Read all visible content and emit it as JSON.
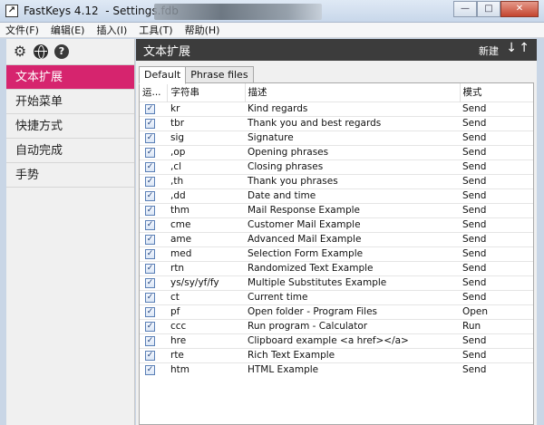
{
  "window": {
    "title": "FastKeys 4.12  - Settings.fdb",
    "app_icon": "↗",
    "minimize": "—",
    "maximize": "□",
    "close": "✕"
  },
  "menu": [
    "文件(F)",
    "编辑(E)",
    "插入(I)",
    "工具(T)",
    "帮助(H)"
  ],
  "toolbar_icons": [
    "gear-icon",
    "globe-icon",
    "help-icon"
  ],
  "toolbar_glyphs": {
    "gear": "⚙",
    "help": "?"
  },
  "nav": [
    {
      "label": "文本扩展",
      "active": true
    },
    {
      "label": "开始菜单",
      "active": false
    },
    {
      "label": "快捷方式",
      "active": false
    },
    {
      "label": "自动完成",
      "active": false
    },
    {
      "label": "手势",
      "active": false
    }
  ],
  "main": {
    "title": "文本扩展",
    "new_label": "新建",
    "down_arrow": "↓",
    "up_arrow": "↑",
    "tabs": [
      "Default",
      "Phrase files"
    ]
  },
  "table": {
    "headers": [
      "运...",
      "字符串",
      "描述",
      "模式"
    ],
    "check_mark": "✓",
    "rows": [
      {
        "abbr": "kr",
        "desc": "Kind regards",
        "mode": "Send"
      },
      {
        "abbr": "tbr",
        "desc": "Thank you and best regards",
        "mode": "Send"
      },
      {
        "abbr": "sig",
        "desc": "Signature",
        "mode": "Send"
      },
      {
        "abbr": ",op",
        "desc": "Opening phrases",
        "mode": "Send"
      },
      {
        "abbr": ",cl",
        "desc": "Closing phrases",
        "mode": "Send"
      },
      {
        "abbr": ",th",
        "desc": "Thank you phrases",
        "mode": "Send"
      },
      {
        "abbr": ",dd",
        "desc": "Date and time",
        "mode": "Send"
      },
      {
        "abbr": "thm",
        "desc": "Mail Response Example",
        "mode": "Send"
      },
      {
        "abbr": "cme",
        "desc": "Customer Mail Example",
        "mode": "Send"
      },
      {
        "abbr": "ame",
        "desc": "Advanced Mail Example",
        "mode": "Send"
      },
      {
        "abbr": "med",
        "desc": "Selection Form Example",
        "mode": "Send"
      },
      {
        "abbr": "rtn",
        "desc": "Randomized Text Example",
        "mode": "Send"
      },
      {
        "abbr": "ys/sy/yf/fy",
        "desc": "Multiple Substitutes Example",
        "mode": "Send"
      },
      {
        "abbr": "ct",
        "desc": "Current time",
        "mode": "Send"
      },
      {
        "abbr": "pf",
        "desc": "Open folder - Program Files",
        "mode": "Open"
      },
      {
        "abbr": "ccc",
        "desc": "Run program - Calculator",
        "mode": "Run"
      },
      {
        "abbr": "hre",
        "desc": "Clipboard example <a href></a>",
        "mode": "Send"
      },
      {
        "abbr": "rte",
        "desc": "Rich Text Example",
        "mode": "Send"
      },
      {
        "abbr": "htm",
        "desc": "HTML Example",
        "mode": "Send"
      }
    ]
  }
}
